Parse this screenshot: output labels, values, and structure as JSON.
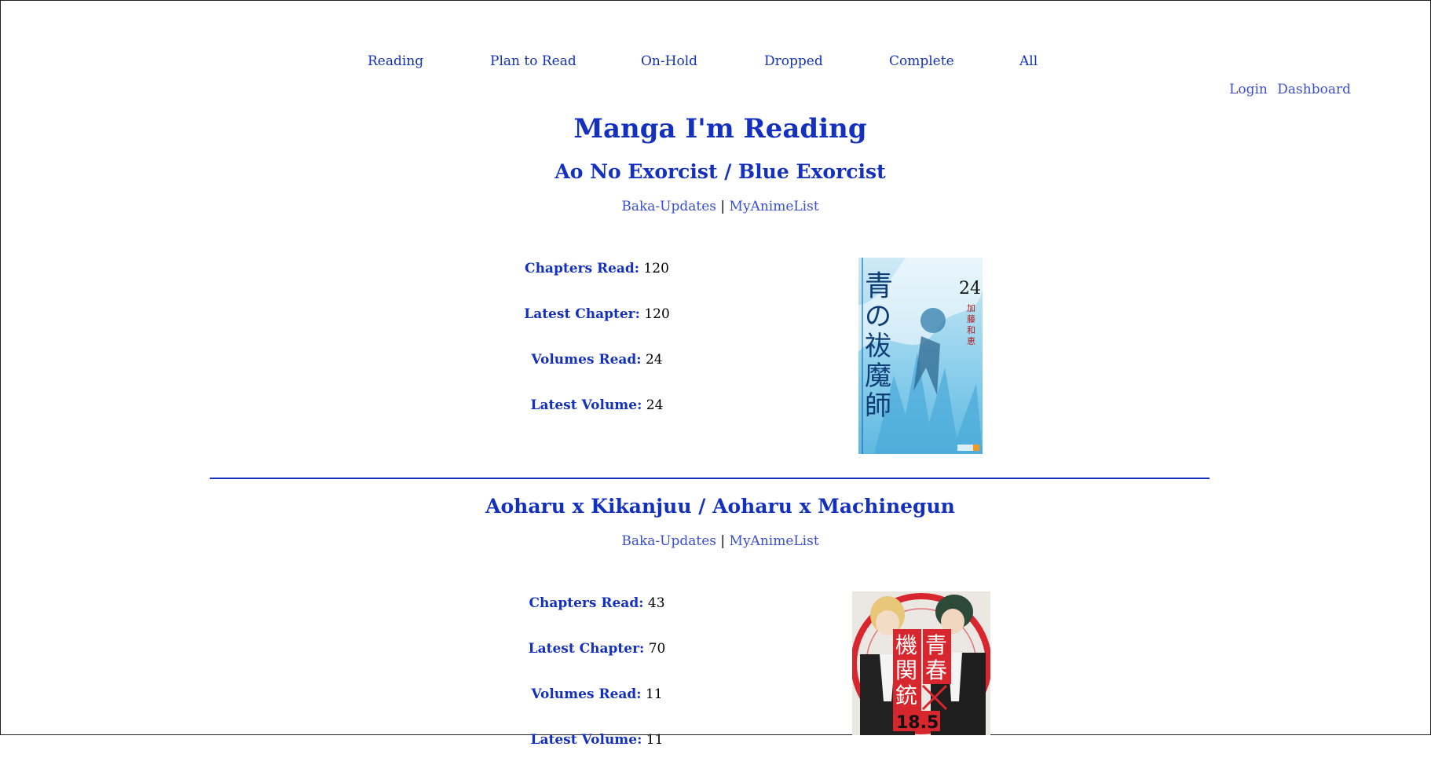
{
  "nav": {
    "items": [
      {
        "label": "Reading"
      },
      {
        "label": "Plan to Read"
      },
      {
        "label": "On-Hold"
      },
      {
        "label": "Dropped"
      },
      {
        "label": "Complete"
      },
      {
        "label": "All"
      }
    ]
  },
  "auth": {
    "login_label": "Login",
    "dashboard_label": "Dashboard"
  },
  "page": {
    "title": "Manga I'm Reading"
  },
  "entries": [
    {
      "title": "Ao No Exorcist / Blue Exorcist",
      "links": {
        "baka": "Baka-Updates",
        "separator": "|",
        "mal": "MyAnimeList"
      },
      "stats": [
        {
          "label": "Chapters Read:",
          "value": "120"
        },
        {
          "label": "Latest Chapter:",
          "value": "120"
        },
        {
          "label": "Volumes Read:",
          "value": "24"
        },
        {
          "label": "Latest Volume:",
          "value": "24"
        }
      ],
      "cover": {
        "title_text": "青の祓魔師",
        "volume": "24",
        "author": "加藤和恵",
        "colors": {
          "bg": "#9fd6ec",
          "accent": "#2aa6d6"
        }
      }
    },
    {
      "title": "Aoharu x Kikanjuu / Aoharu x Machinegun",
      "links": {
        "baka": "Baka-Updates",
        "separator": "|",
        "mal": "MyAnimeList"
      },
      "stats": [
        {
          "label": "Chapters Read:",
          "value": "43"
        },
        {
          "label": "Latest Chapter:",
          "value": "70"
        },
        {
          "label": "Volumes Read:",
          "value": "11"
        },
        {
          "label": "Latest Volume:",
          "value": "11"
        }
      ],
      "cover": {
        "title_a": "青春",
        "title_b": "機関銃",
        "volume": "18.5",
        "colors": {
          "bg": "#e8e4e0",
          "accent": "#d8262e"
        }
      }
    }
  ],
  "colors": {
    "link": "#1433b3",
    "heading": "#1430bf",
    "secondary_link": "#3b4fd0"
  }
}
